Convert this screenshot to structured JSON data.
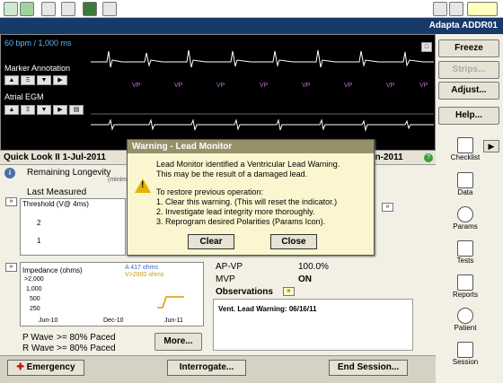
{
  "header": {
    "device": "Adapta ADDR01"
  },
  "ecg": {
    "rate": "60 bpm / 1,000 ms",
    "marker_label": "Marker Annotation",
    "atrial_label": "Atrial EGM",
    "marker_codes": [
      "VP",
      "VP",
      "VP",
      "VP",
      "VP",
      "VP",
      "VP",
      "VP"
    ]
  },
  "right_buttons": {
    "freeze": "Freeze",
    "strips": "Strips...",
    "adjust": "Adjust...",
    "help": "Help..."
  },
  "quicklook": {
    "title": "Quick Look II  1-Jul-2011",
    "date_right": "6-Jun-2011",
    "remaining": "Remaining Longevity",
    "remaining_sub": "(minim",
    "last_measured": "Last Measured"
  },
  "threshold_chart": {
    "label": "Threshold (V@ 4ms)",
    "ticks": [
      "2",
      "1"
    ]
  },
  "impedance_chart": {
    "label": "Impedance (ohms)",
    "ticks": [
      ">2,000",
      "1,000",
      "500",
      "250"
    ],
    "x_ticks": [
      "Jun-10",
      "Dec-10",
      "Jun-11"
    ],
    "legend": [
      "A   417 ohms",
      "V>2000 ohms"
    ]
  },
  "summary": {
    "p_wave_label": "P Wave",
    ">=": "",
    "p_wave_value": ">= 80% Paced",
    "r_wave_label": "R Wave",
    "r_wave_value": ">= 80% Paced",
    "more": "More..."
  },
  "pacing": {
    "ap_vp_label": "AP-VP",
    "ap_vp_value": "100.0%",
    "mvp_label": "MVP",
    "mvp_value": "ON"
  },
  "observations": {
    "title": "Observations",
    "item": "Vent. Lead Warning: 06/16/11"
  },
  "nav": [
    "Checklist",
    "Data",
    "Params",
    "Tests",
    "Reports",
    "Patient",
    "Session"
  ],
  "bottom": {
    "emergency": "Emergency",
    "interrogate": "Interrogate...",
    "end": "End Session..."
  },
  "dialog": {
    "title": "Warning - Lead Monitor",
    "lines": [
      "Lead Monitor identified a Ventricular Lead Warning.",
      "This may be the result of a damaged lead.",
      "",
      "To restore previous operation:",
      "1. Clear this warning. (This will reset the indicator.)",
      "2. Investigate lead integrity more thoroughly.",
      "3. Reprogram desired Polarities (Params Icon)."
    ],
    "clear": "Clear",
    "close": "Close"
  },
  "colors": {
    "accent": "#173a6b",
    "marker": "#c070d0",
    "warning": "#e0b400",
    "emergency": "#cc1111"
  }
}
